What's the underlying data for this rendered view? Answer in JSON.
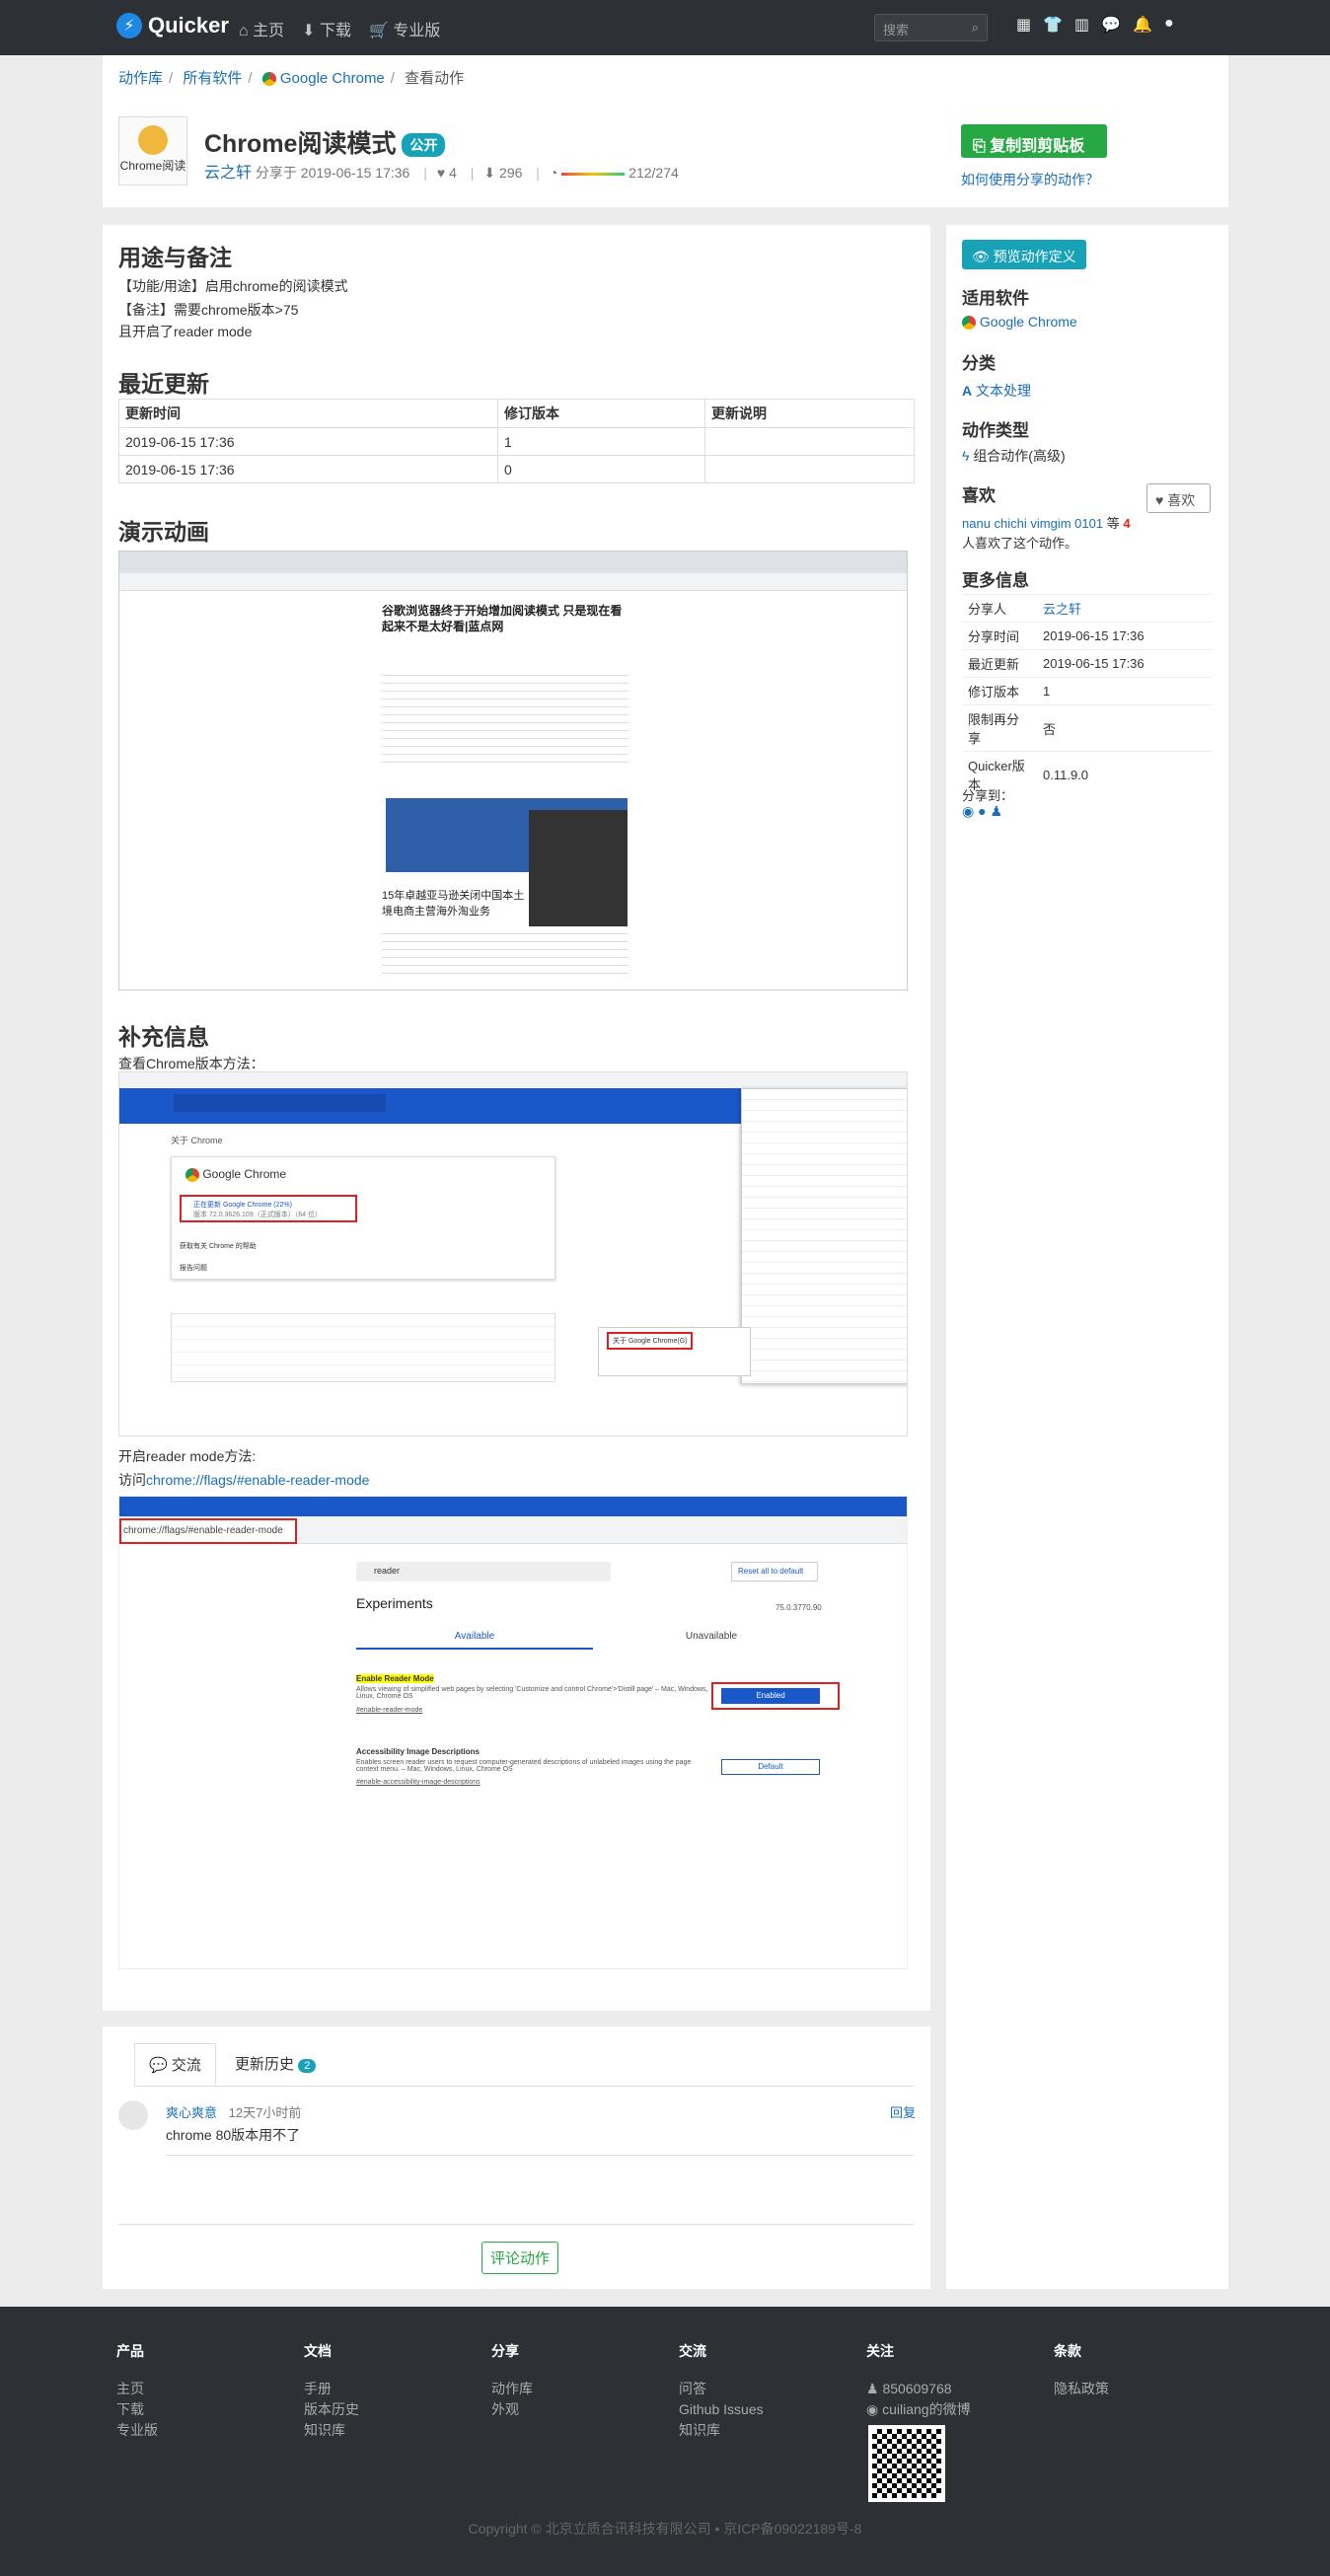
{
  "nav": {
    "brand": "Quicker",
    "links": [
      "主页",
      "下载",
      "专业版"
    ],
    "search_placeholder": "搜索"
  },
  "breadcrumb": [
    "动作库",
    "所有软件",
    "Google Chrome",
    "查看动作"
  ],
  "action": {
    "icon_label": "Chrome阅读",
    "title": "Chrome阅读模式",
    "status": "公开",
    "author": "云之轩",
    "shared_at": "分享于 2019-06-15 17:36",
    "likes": "4",
    "downloads": "296",
    "quality": "212/274"
  },
  "header": {
    "copy_button": "复制到剪贴板",
    "how_to": "如何使用分享的动作？"
  },
  "usage": {
    "heading": "用途与备注",
    "lines": [
      "【功能/用途】启用chrome的阅读模式",
      "【备注】需要chrome版本>75",
      "且开启了reader mode"
    ]
  },
  "updates": {
    "heading": "最近更新",
    "columns": [
      "更新时间",
      "修订版本",
      "更新说明"
    ],
    "rows": [
      [
        "2019-06-15 17:36",
        "1",
        ""
      ],
      [
        "2019-06-15 17:36",
        "0",
        ""
      ]
    ]
  },
  "demo": {
    "heading": "演示动画",
    "article_title": "谷歌浏览器终于开始增加阅读模式 只是现在看起来不是太好看|蓝点网",
    "sub_title": "15年卓越亚马逊关闭中国本土境电商主营海外淘业务"
  },
  "extra": {
    "heading": "补充信息",
    "line1": "查看Chrome版本方法：",
    "line2": "开启reader mode方法:",
    "line3_prefix": "访问",
    "line3_link": "chrome://flags/#enable-reader-mode",
    "chrome_about": "关于 Chrome",
    "chrome_name": "Google Chrome",
    "updating": "正在更新 Google Chrome (22%)",
    "version": "版本 72.0.3626.109（正式版本）（64 位）",
    "help": "获取有关 Chrome 的帮助",
    "report": "报告问题",
    "about_menu": "关于 Google Chrome(G)",
    "flags_url": "chrome://flags/#enable-reader-mode",
    "flags_search": "reader",
    "reset": "Reset all to default",
    "experiments": "Experiments",
    "flags_version": "75.0.3770.90",
    "available": "Available",
    "unavailable": "Unavailable",
    "flag1_title": "Enable Reader Mode",
    "flag1_desc": "Allows viewing of simplified web pages by selecting 'Customize and control Chrome'>'Distill page' – Mac, Windows, Linux, Chrome OS",
    "flag1_link": "#enable-reader-mode",
    "flag1_value": "Enabled",
    "flag2_title": "Accessibility Image Descriptions",
    "flag2_desc": "Enables screen reader users to request computer-generated descriptions of unlabeled images using the page context menu. – Mac, Windows, Linux, Chrome OS",
    "flag2_link": "#enable-accessibility-image-descriptions",
    "flag2_value": "Default"
  },
  "comments": {
    "tab1": "交流",
    "tab2": "更新历史",
    "tab2_count": "2",
    "user": "爽心爽意",
    "time": "12天7小时前",
    "reply": "回复",
    "text": "chrome 80版本用不了",
    "button": "评论动作"
  },
  "sidebar": {
    "preview": "预览动作定义",
    "software_h": "适用软件",
    "software": "Google Chrome",
    "category_h": "分类",
    "category": "文本处理",
    "type_h": "动作类型",
    "type": "组合动作(高级)",
    "like_h": "喜欢",
    "like_btn": "喜欢",
    "likers": "nanu chichi vimgim 0101",
    "likers_suffix": "等",
    "likers_count": "4",
    "likers_tail": "人喜欢了这个动作。",
    "more_h": "更多信息",
    "info": [
      [
        "分享人",
        "云之轩"
      ],
      [
        "分享时间",
        "2019-06-15 17:36"
      ],
      [
        "最近更新",
        "2019-06-15 17:36"
      ],
      [
        "修订版本",
        "1"
      ],
      [
        "限制再分享",
        "否"
      ],
      [
        "Quicker版本",
        "0.11.9.0"
      ]
    ],
    "share_h": "分享到："
  },
  "footer": {
    "cols": [
      {
        "title": "产品",
        "items": [
          "主页",
          "下载",
          "专业版"
        ]
      },
      {
        "title": "文档",
        "items": [
          "手册",
          "版本历史",
          "知识库"
        ]
      },
      {
        "title": "分享",
        "items": [
          "动作库",
          "外观"
        ]
      },
      {
        "title": "交流",
        "items": [
          "问答",
          "Github Issues",
          "知识库"
        ]
      },
      {
        "title": "关注",
        "items": [
          "850609768",
          "cuiliang的微博"
        ]
      },
      {
        "title": "条款",
        "items": [
          "隐私政策"
        ]
      }
    ],
    "copyright": "Copyright © 北京立质合讯科技有限公司 • 京ICP备09022189号-8"
  }
}
